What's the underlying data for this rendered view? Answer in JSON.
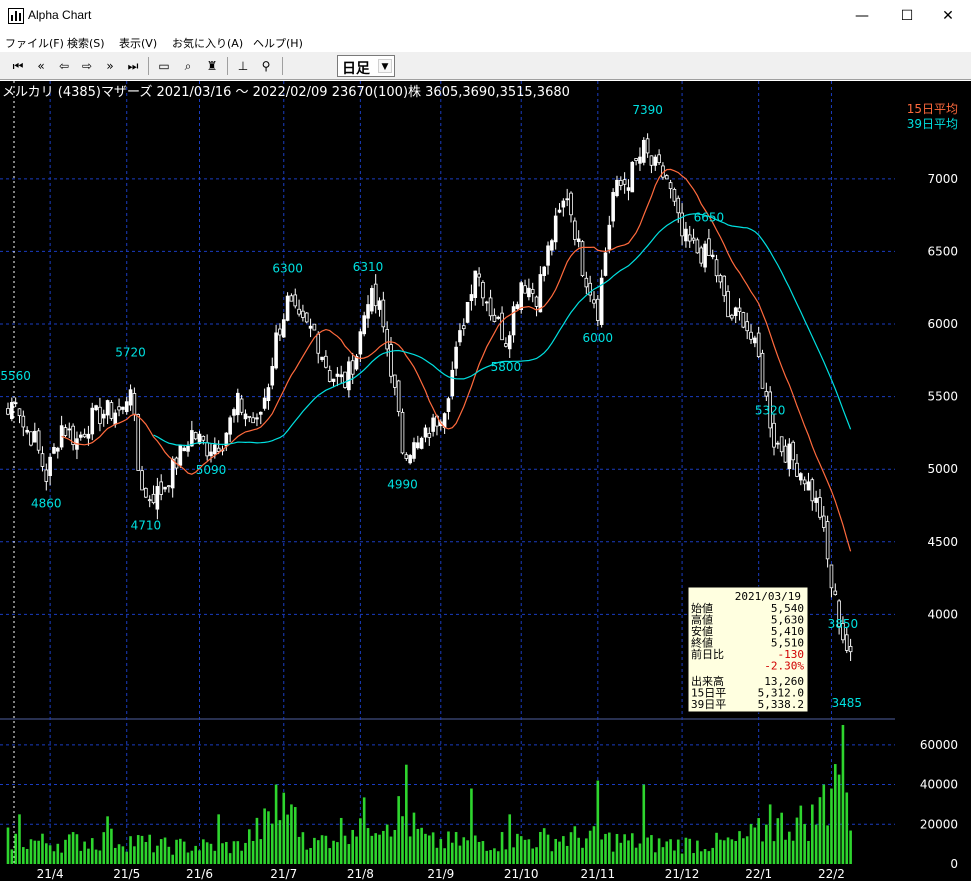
{
  "window": {
    "title": "Alpha Chart",
    "icon": "app-chart-icon",
    "minimize_glyph": "—",
    "maximize_glyph": "☐",
    "close_glyph": "✕"
  },
  "menu": [
    "ファイル(F)",
    "検索(S)",
    "表示(V)",
    "お気に入り(A)",
    "ヘルプ(H)"
  ],
  "toolbar": {
    "buttons": [
      {
        "icon": "jump-first-icon",
        "glyph": "⏮"
      },
      {
        "icon": "fast-back-icon",
        "glyph": "«"
      },
      {
        "icon": "back-arrow-icon",
        "glyph": "⇦"
      },
      {
        "icon": "forward-arrow-icon",
        "glyph": "⇨"
      },
      {
        "icon": "fast-forward-icon",
        "glyph": "»"
      },
      {
        "icon": "jump-last-icon",
        "glyph": "⏭"
      },
      {
        "icon": "folder-icon",
        "glyph": "▭"
      },
      {
        "icon": "search-icon",
        "glyph": "⌕"
      },
      {
        "icon": "tree-icon",
        "glyph": "♜"
      },
      {
        "icon": "chart-settings-icon",
        "glyph": "⊥"
      },
      {
        "icon": "zoom-icon",
        "glyph": "⚲"
      }
    ],
    "period_selected": "日足",
    "period_arrow": "▼"
  },
  "colors": {
    "background": "#000000",
    "grid": "#1a3cc0",
    "text": "#ffffff",
    "labels": "#00e0e0",
    "candle_up": "#ffffff",
    "candle_down": "#000000",
    "ma15": "#ff6a3d",
    "ma39": "#00e0e0",
    "volume": "#2ed52e",
    "tooltip_bg": "#ffffe0",
    "negative": "#d00000"
  },
  "chart_data": {
    "type": "candlestick",
    "header": "メルカリ  (4385)マザーズ 2021/03/16 ～ 2022/02/09  23670(100)株 3605,3690,3515,3680",
    "legend": [
      {
        "name": "15日平均",
        "color": "#ff6a3d"
      },
      {
        "name": "39日平均",
        "color": "#00e0e0"
      }
    ],
    "price_ylim": [
      3300,
      7550
    ],
    "price_ticks": [
      4000,
      4500,
      5000,
      5500,
      6000,
      6500,
      7000
    ],
    "price_tick_labels": [
      "4000",
      "4500",
      "5000",
      "5500",
      "6000",
      "6500",
      "7000"
    ],
    "volume_ylim": [
      0,
      72000
    ],
    "volume_ticks": [
      0,
      20000,
      40000,
      60000
    ],
    "volume_tick_labels": [
      "0",
      "20000",
      "40000",
      "60000"
    ],
    "x_labels": [
      "21/4",
      "21/5",
      "21/6",
      "21/7",
      "21/8",
      "21/9",
      "21/10",
      "21/11",
      "21/12",
      "22/1",
      "22/2"
    ],
    "x_label_index": [
      11,
      31,
      50,
      72,
      92,
      113,
      134,
      154,
      176,
      196,
      215
    ],
    "annotations": [
      {
        "text": "5560",
        "index": 2,
        "value": 5560,
        "pos": "above"
      },
      {
        "text": "4860",
        "index": 10,
        "value": 4860,
        "pos": "below"
      },
      {
        "text": "5720",
        "index": 32,
        "value": 5720,
        "pos": "above"
      },
      {
        "text": "4710",
        "index": 36,
        "value": 4710,
        "pos": "below"
      },
      {
        "text": "5090",
        "index": 53,
        "value": 5090,
        "pos": "below"
      },
      {
        "text": "6300",
        "index": 73,
        "value": 6300,
        "pos": "above"
      },
      {
        "text": "6310",
        "index": 94,
        "value": 6310,
        "pos": "above"
      },
      {
        "text": "4990",
        "index": 103,
        "value": 4990,
        "pos": "below"
      },
      {
        "text": "5800",
        "index": 130,
        "value": 5800,
        "pos": "below"
      },
      {
        "text": "6000",
        "index": 154,
        "value": 6000,
        "pos": "below"
      },
      {
        "text": "7390",
        "index": 167,
        "value": 7390,
        "pos": "above"
      },
      {
        "text": "6650",
        "index": 183,
        "value": 6650,
        "pos": "above"
      },
      {
        "text": "5320",
        "index": 199,
        "value": 5320,
        "pos": "above"
      },
      {
        "text": "3850",
        "index": 218,
        "value": 3850,
        "pos": "above"
      },
      {
        "text": "3485",
        "index": 219,
        "value": 3485,
        "pos": "below"
      }
    ],
    "close_keypoints": [
      [
        0,
        5380
      ],
      [
        2,
        5520
      ],
      [
        4,
        5300
      ],
      [
        7,
        5200
      ],
      [
        10,
        4950
      ],
      [
        14,
        5300
      ],
      [
        18,
        5200
      ],
      [
        22,
        5350
      ],
      [
        26,
        5400
      ],
      [
        30,
        5400
      ],
      [
        32,
        5600
      ],
      [
        34,
        5000
      ],
      [
        36,
        4800
      ],
      [
        40,
        4850
      ],
      [
        44,
        5050
      ],
      [
        48,
        5250
      ],
      [
        52,
        5150
      ],
      [
        56,
        5200
      ],
      [
        60,
        5450
      ],
      [
        65,
        5300
      ],
      [
        68,
        5600
      ],
      [
        70,
        5900
      ],
      [
        73,
        6150
      ],
      [
        76,
        6000
      ],
      [
        80,
        5950
      ],
      [
        84,
        5650
      ],
      [
        88,
        5600
      ],
      [
        91,
        5800
      ],
      [
        94,
        6200
      ],
      [
        97,
        6100
      ],
      [
        100,
        5700
      ],
      [
        103,
        5150
      ],
      [
        107,
        5150
      ],
      [
        111,
        5300
      ],
      [
        114,
        5450
      ],
      [
        118,
        5900
      ],
      [
        122,
        6400
      ],
      [
        126,
        6100
      ],
      [
        130,
        5900
      ],
      [
        134,
        6300
      ],
      [
        138,
        6200
      ],
      [
        142,
        6600
      ],
      [
        146,
        6900
      ],
      [
        150,
        6400
      ],
      [
        154,
        6100
      ],
      [
        158,
        6900
      ],
      [
        162,
        7000
      ],
      [
        166,
        7200
      ],
      [
        168,
        7100
      ],
      [
        172,
        7000
      ],
      [
        176,
        6600
      ],
      [
        180,
        6500
      ],
      [
        184,
        6450
      ],
      [
        188,
        6050
      ],
      [
        192,
        6050
      ],
      [
        196,
        5750
      ],
      [
        200,
        5200
      ],
      [
        204,
        5100
      ],
      [
        208,
        4950
      ],
      [
        212,
        4700
      ],
      [
        215,
        4200
      ],
      [
        218,
        3850
      ],
      [
        220,
        3680
      ]
    ],
    "volume_keypoints": [
      [
        0,
        14000
      ],
      [
        10,
        12000
      ],
      [
        30,
        14000
      ],
      [
        40,
        10000
      ],
      [
        60,
        10000
      ],
      [
        72,
        30000
      ],
      [
        80,
        11000
      ],
      [
        92,
        25000
      ],
      [
        102,
        28000
      ],
      [
        110,
        12000
      ],
      [
        130,
        13000
      ],
      [
        150,
        15000
      ],
      [
        170,
        11000
      ],
      [
        190,
        12000
      ],
      [
        200,
        21000
      ],
      [
        210,
        25000
      ],
      [
        214,
        34000
      ],
      [
        218,
        70000
      ],
      [
        220,
        24000
      ]
    ],
    "volume_spikes": [
      [
        3,
        25000
      ],
      [
        26,
        24000
      ],
      [
        55,
        25000
      ],
      [
        70,
        40000
      ],
      [
        74,
        30000
      ],
      [
        104,
        50000
      ],
      [
        121,
        38000
      ],
      [
        131,
        25000
      ],
      [
        154,
        42000
      ],
      [
        166,
        40000
      ],
      [
        199,
        30000
      ],
      [
        213,
        40000
      ],
      [
        215,
        38000
      ],
      [
        218,
        70000
      ],
      [
        219,
        36000
      ]
    ],
    "bars": 221,
    "tooltip": {
      "date": "2021/03/19",
      "rows": [
        {
          "label": "始値",
          "value": "5,540"
        },
        {
          "label": "高値",
          "value": "5,630"
        },
        {
          "label": "安値",
          "value": "5,410"
        },
        {
          "label": "終値",
          "value": "5,510"
        },
        {
          "label": "前日比",
          "value": "-130"
        },
        {
          "label": "",
          "value": "-2.30%"
        },
        {
          "label": "出来高",
          "value": "13,260"
        },
        {
          "label": "15日平",
          "value": "5,312.0"
        },
        {
          "label": "39日平",
          "value": "5,338.2"
        }
      ]
    }
  }
}
